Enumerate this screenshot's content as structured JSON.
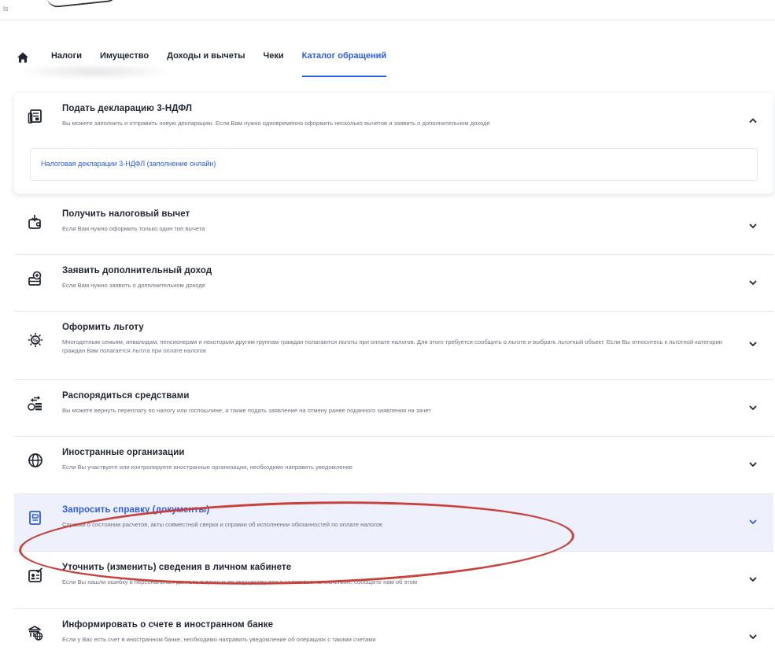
{
  "topbar": {
    "glyph": "ls"
  },
  "nav": {
    "home_icon": "home-icon",
    "tabs": [
      {
        "label": "Налоги",
        "active": false
      },
      {
        "label": "Имущество",
        "active": false
      },
      {
        "label": "Доходы и вычеты",
        "active": false
      },
      {
        "label": "Чеки",
        "active": false
      },
      {
        "label": "Каталог обращений",
        "active": true
      }
    ]
  },
  "colors": {
    "accent": "#2b5ce6",
    "annotation": "#c9413b",
    "highlight_bg": "#eef1fb"
  },
  "catalog": {
    "expanded": {
      "icon": "declaration-icon",
      "title": "Подать декларацию 3-НДФЛ",
      "description": "Вы можете заполнить и отправить новую декларацию. Если Вам нужно одновременно оформить несколько вычетов и заявить о дополнительном доходе",
      "link": "Налоговая декларации 3-НДФЛ (заполнение онлайн)"
    },
    "items": [
      {
        "icon": "tax-deduction-icon",
        "title": "Получить налоговый вычет",
        "description": "Если Вам нужно оформить только один тип вычета"
      },
      {
        "icon": "additional-income-icon",
        "title": "Заявить дополнительный доход",
        "description": "Если Вам нужно заявить о дополнительном доходе"
      },
      {
        "icon": "benefit-icon",
        "title": "Оформить льготу",
        "description": "Многодетным семьям, инвалидам, пенсионерам и некоторым другим группам граждан полагаются льготы при оплате налогов. Для этого требуется сообщить о льготе и выбрать льготный объект. Если Вы относитесь к льготной категории граждан Вам полагается льгота при оплате налогов"
      },
      {
        "icon": "funds-icon",
        "title": "Распорядиться средствами",
        "description": "Вы можете вернуть переплату по налогу или госпошлине, а также подать заявление на отмену ранее поданного заявления на зачет"
      },
      {
        "icon": "globe-icon",
        "title": "Иностранные организации",
        "description": "Если Вы участвуете или контролируете иностранные организации, необходимо направить уведомление"
      },
      {
        "icon": "certificate-icon",
        "title": "Запросить справку (документы)",
        "description": "Справки о состоянии расчетов, акты совместной сверки и справки об исполнении обязанностей по оплате налогов",
        "highlighted": true
      },
      {
        "icon": "profile-edit-icon",
        "title": "Уточнить (изменить) сведения в личном кабинете",
        "description": "Если Вы нашли ошибку в персональных данных, в данных по имуществу или в налоговых начислениях, сообщите нам об этом"
      },
      {
        "icon": "foreign-bank-icon",
        "title": "Информировать о счете в иностранном банке",
        "description": "Если у Вас есть счет в иностранном банке, необходимо направить уведомление об операциях с такими счетами"
      }
    ]
  }
}
